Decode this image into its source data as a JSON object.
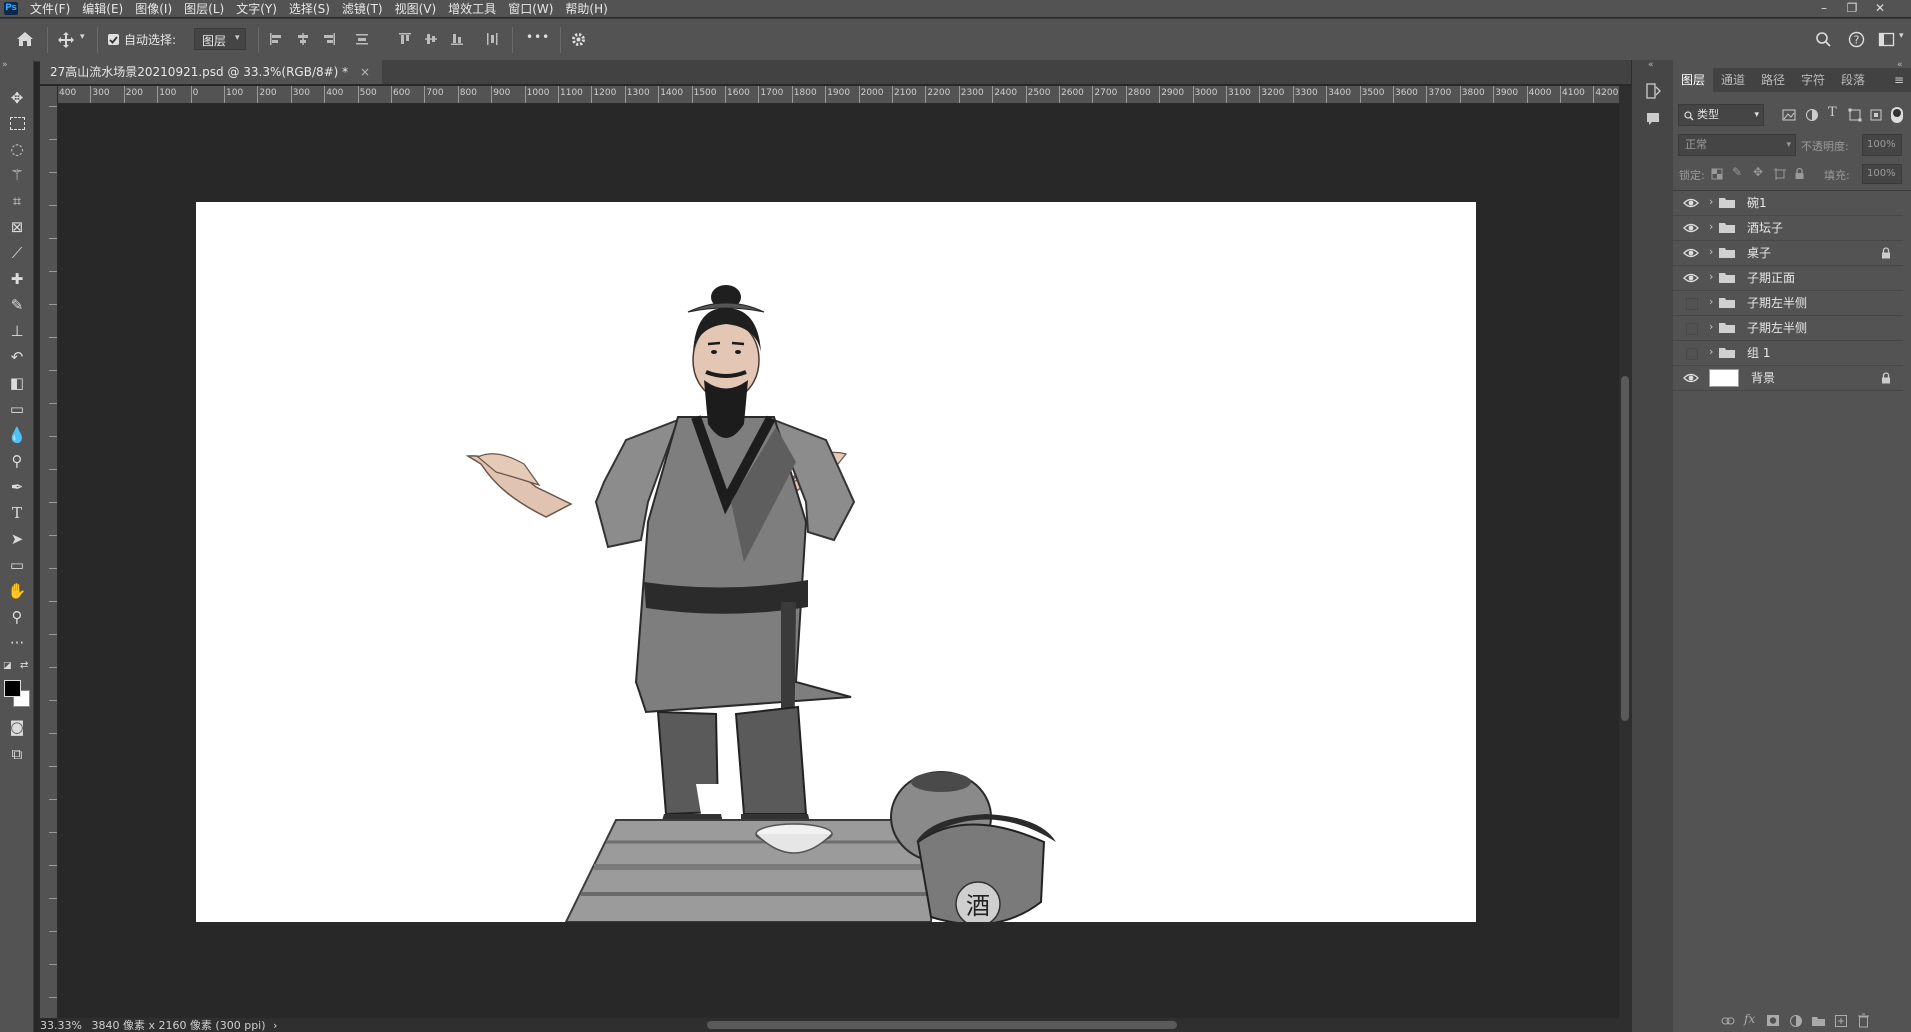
{
  "menubar": {
    "items": [
      "文件(F)",
      "编辑(E)",
      "图像(I)",
      "图层(L)",
      "文字(Y)",
      "选择(S)",
      "滤镜(T)",
      "视图(V)",
      "增效工具",
      "窗口(W)",
      "帮助(H)"
    ],
    "window_controls": [
      "minimize-icon",
      "restore-icon",
      "close-icon"
    ]
  },
  "options": {
    "auto_select_label": "自动选择:",
    "auto_select_checked": true,
    "target_value": "图层",
    "more_label": "•••"
  },
  "document": {
    "tab_title": "27高山流水场景20210921.psd @ 33.3%(RGB/8#) *"
  },
  "ruler": {
    "h_labels": [
      "400",
      "300",
      "200",
      "100",
      "0",
      "100",
      "200",
      "300",
      "400",
      "500",
      "600",
      "700",
      "800",
      "900",
      "1000",
      "1100",
      "1200",
      "1300",
      "1400",
      "1500",
      "1600",
      "1700",
      "1800",
      "1900",
      "2000",
      "2100",
      "2200",
      "2300",
      "2400",
      "2500",
      "2600",
      "2700",
      "2800",
      "2900",
      "3000",
      "3100",
      "3200",
      "3300",
      "3400",
      "3500",
      "3600",
      "3700",
      "3800",
      "3900",
      "4000",
      "4100",
      "4200"
    ]
  },
  "canvas": {
    "jar_character": "酒"
  },
  "status": {
    "zoom": "33.33%",
    "dimensions": "3840 像素 x 2160 像素 (300 ppi)"
  },
  "layers_panel": {
    "tabs": [
      "图层",
      "通道",
      "路径",
      "字符",
      "段落"
    ],
    "active_tab": "图层",
    "filter_label": "类型",
    "blend_mode": "正常",
    "opacity_label": "不透明度:",
    "opacity_value": "100%",
    "lock_label": "锁定:",
    "fill_label": "填充:",
    "fill_value": "100%",
    "layers": [
      {
        "name": "碗1",
        "visible": true,
        "type": "group",
        "locked": false
      },
      {
        "name": "酒坛子",
        "visible": true,
        "type": "group",
        "locked": false
      },
      {
        "name": "桌子",
        "visible": true,
        "type": "group",
        "locked": true
      },
      {
        "name": "子期正面",
        "visible": true,
        "type": "group",
        "locked": false
      },
      {
        "name": "子期左半侧",
        "visible": false,
        "type": "group",
        "locked": false
      },
      {
        "name": "子期左半侧",
        "visible": false,
        "type": "group",
        "locked": false
      },
      {
        "name": "组 1",
        "visible": false,
        "type": "group",
        "locked": false
      },
      {
        "name": "背景",
        "visible": true,
        "type": "background",
        "locked": true
      }
    ]
  },
  "colors": {
    "ui_panel": "#535353",
    "ui_dark": "#282828",
    "accent": "#31a8ff"
  }
}
